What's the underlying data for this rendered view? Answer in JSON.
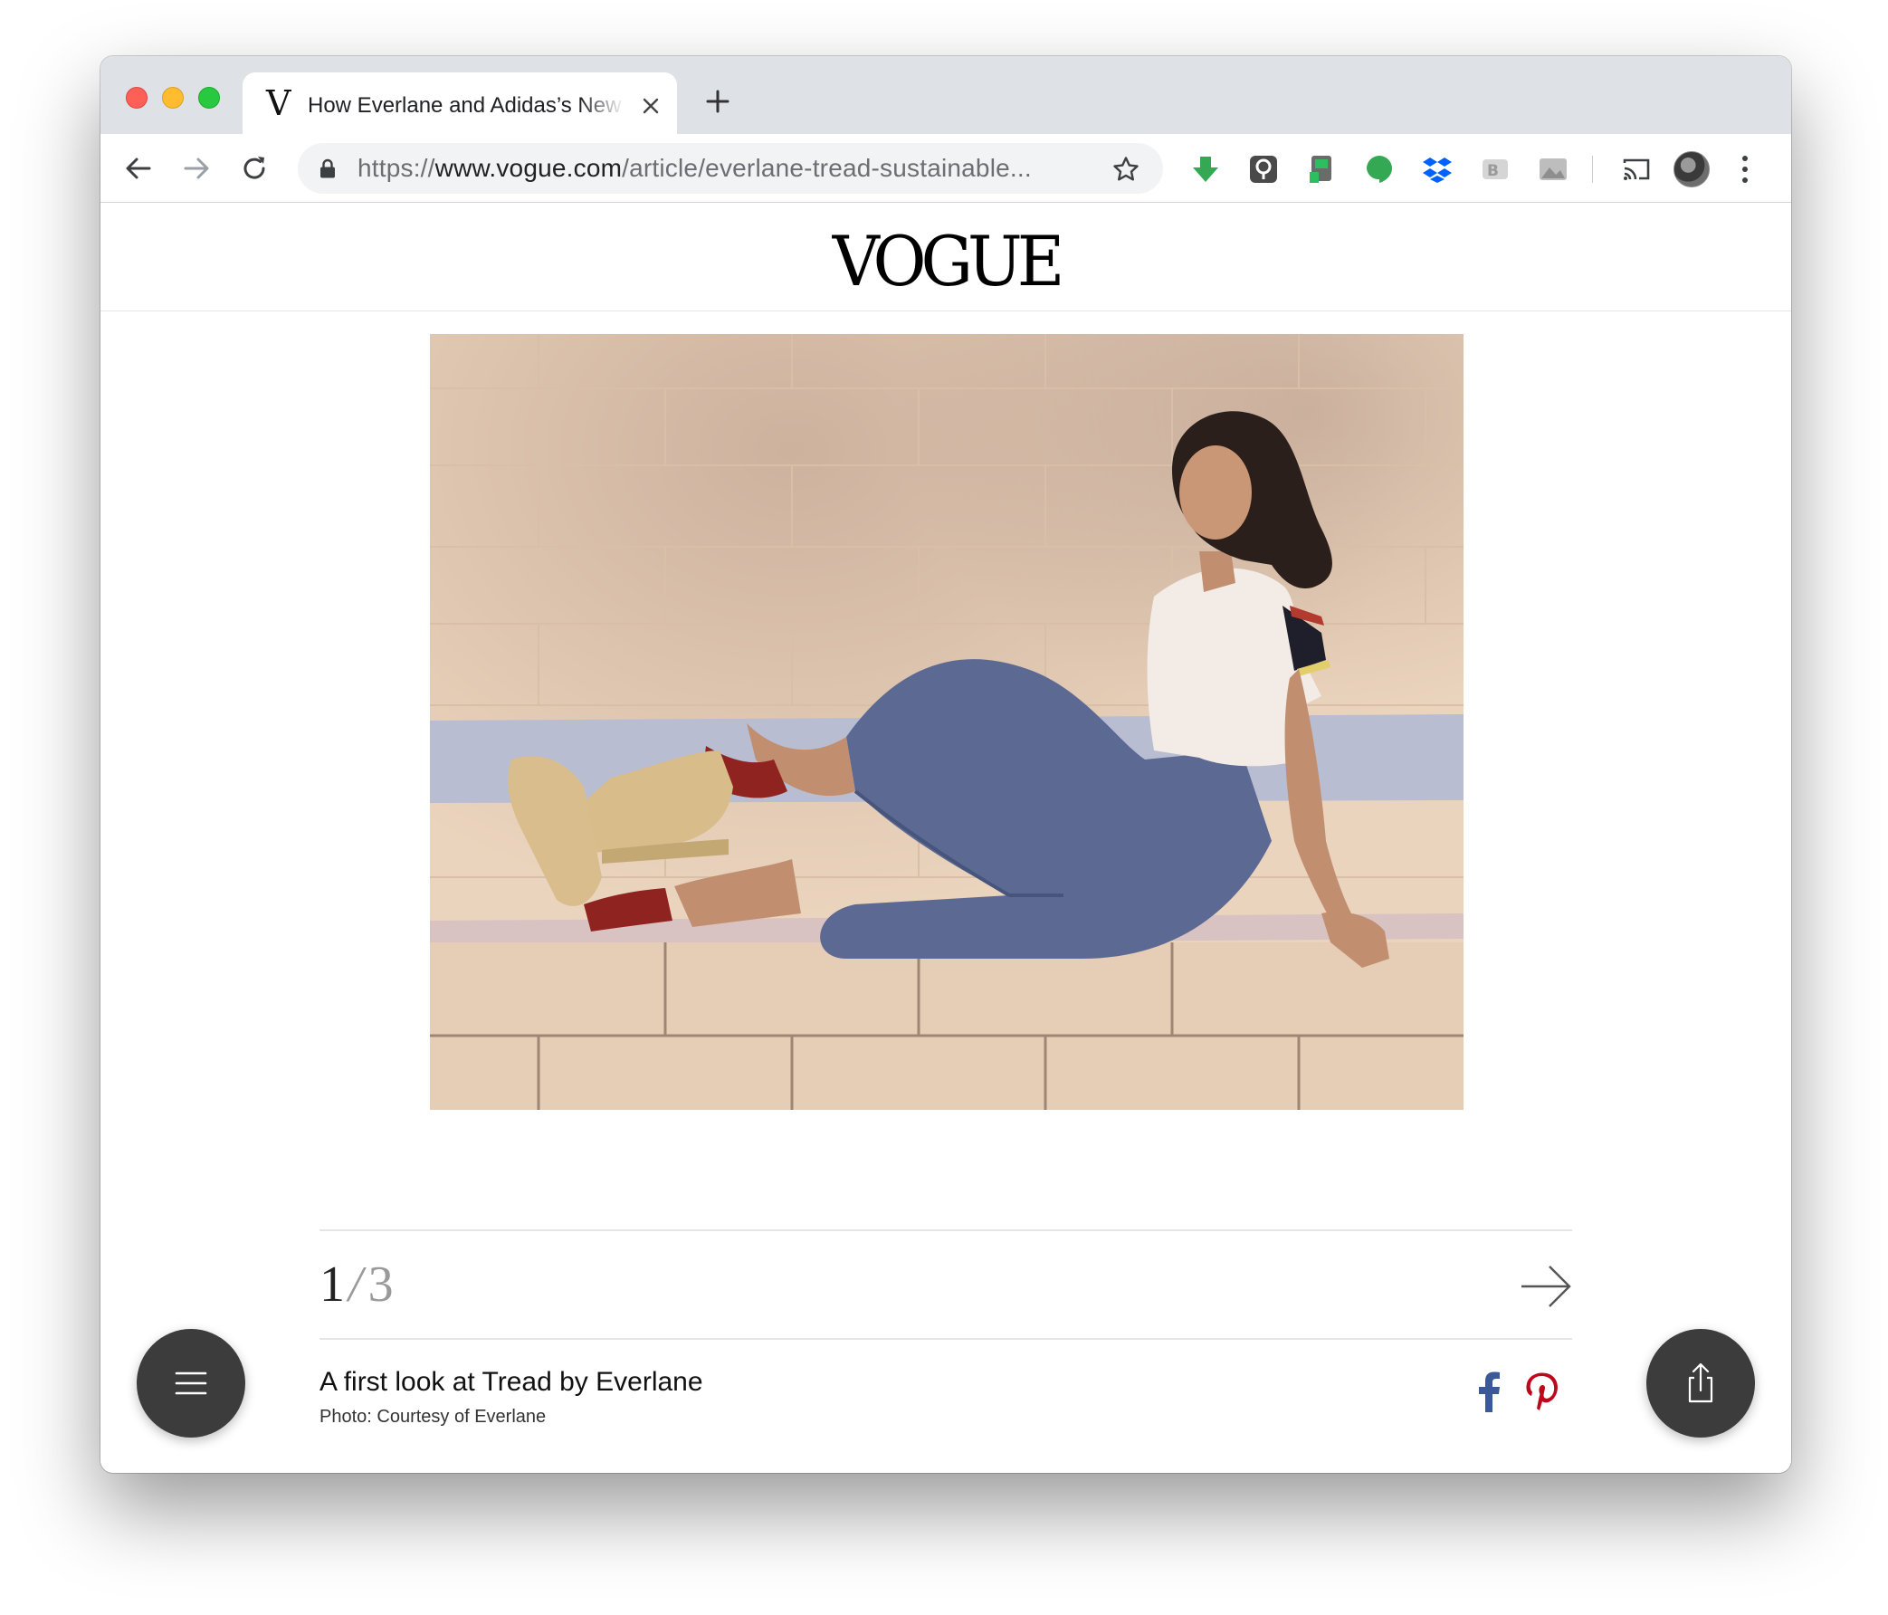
{
  "browser": {
    "tab": {
      "favicon": "V",
      "title": "How Everlane and Adidas’s New Sneakers Are Changing Sustainable Fashion"
    },
    "address_bar": {
      "url_prefix": "https://",
      "url_host": "www.vogue.com",
      "url_path": "/article/everlane-tread-sustainable..."
    },
    "icons": [
      "back-icon",
      "forward-icon",
      "reload-icon",
      "lock-icon",
      "star-icon",
      "download-icon",
      "keeper-icon",
      "evernote-icon",
      "hangouts-icon",
      "dropbox-icon",
      "bear-icon",
      "image-icon",
      "cast-icon",
      "kebab-menu-icon"
    ]
  },
  "site": {
    "logo": "VOGUE"
  },
  "gallery": {
    "current": "1",
    "separator": "/",
    "total": "3",
    "caption": "A first look at Tread by Everlane",
    "credit": "Photo: Courtesy of Everlane"
  },
  "colors": {
    "facebook": "#3b5998",
    "pinterest": "#bd081c",
    "fab_background": "#3c3c3c",
    "download_green": "#34a853"
  }
}
